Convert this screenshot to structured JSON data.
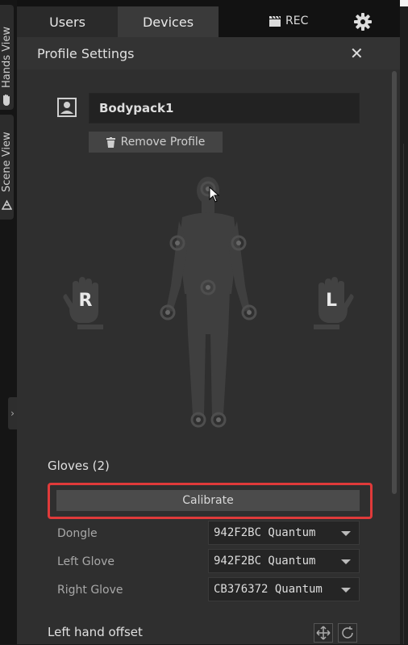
{
  "side_tabs": {
    "hands_view": "Hands View",
    "scene_view": "Scene View"
  },
  "top_tabs": {
    "users": "Users",
    "devices": "Devices",
    "rec": "REC"
  },
  "panel": {
    "title": "Profile Settings",
    "profile_name": "Bodypack1",
    "remove_profile": "Remove Profile",
    "hands": {
      "right": "R",
      "left": "L"
    }
  },
  "gloves": {
    "title": "Gloves (2)",
    "calibrate": "Calibrate",
    "fields": [
      {
        "label": "Dongle",
        "value": "942F2BC Quantum"
      },
      {
        "label": "Left Glove",
        "value": "942F2BC Quantum"
      },
      {
        "label": "Right Glove",
        "value": "CB376372 Quantum"
      }
    ]
  },
  "offset": {
    "title": "Left hand offset"
  },
  "colors": {
    "highlight": "#e03a3a",
    "panel_bg": "#2f2f2f",
    "figure": "#3e3e3e"
  },
  "icons": [
    "hand-icon",
    "scene-icon",
    "chevron-right-icon",
    "clapperboard-icon",
    "gear-icon",
    "close-icon",
    "user-profile-icon",
    "trash-icon",
    "move-icon",
    "reset-icon",
    "caret-down-icon"
  ]
}
